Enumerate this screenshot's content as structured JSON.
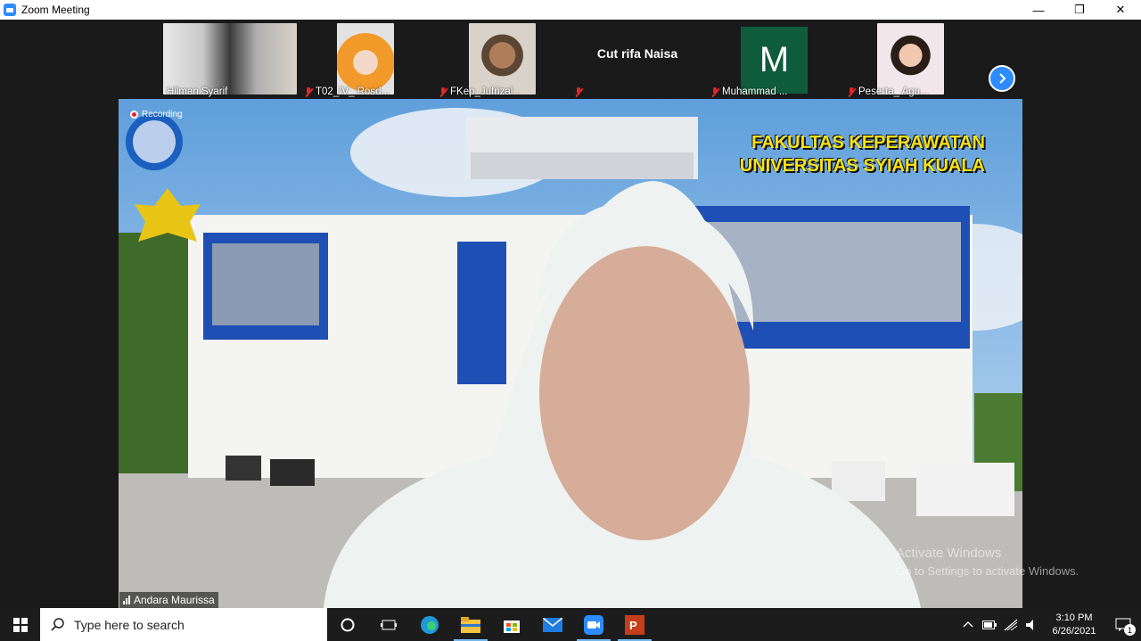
{
  "window": {
    "title": "Zoom Meeting"
  },
  "gallery": [
    {
      "name": "Hilman Syarif",
      "muted": false
    },
    {
      "name": "T02_IV_ Rosd...",
      "muted": true
    },
    {
      "name": "FKep_Jufrizal .",
      "muted": true
    },
    {
      "name": "",
      "display_name": "Cut rifa Naisa",
      "muted": true
    },
    {
      "name": "Muhammad ...",
      "avatar_letter": "M",
      "muted": true
    },
    {
      "name": "Peserta_ Agu...",
      "muted": true
    }
  ],
  "stage": {
    "recording_label": "Recording",
    "banner_line1": "FAKULTAS KEPERAWATAN",
    "banner_line2": "UNIVERSITAS SYIAH KUALA",
    "speaker_name": "Andara Maurissa"
  },
  "watermark": {
    "line1": "Activate Windows",
    "line2": "Go to Settings to activate Windows."
  },
  "taskbar": {
    "search_placeholder": "Type here to search",
    "time": "3:10 PM",
    "date": "6/26/2021",
    "notification_count": "1"
  },
  "colors": {
    "accent": "#2d8cff",
    "muted": "#e02828",
    "banner_text": "#f7e21a"
  }
}
